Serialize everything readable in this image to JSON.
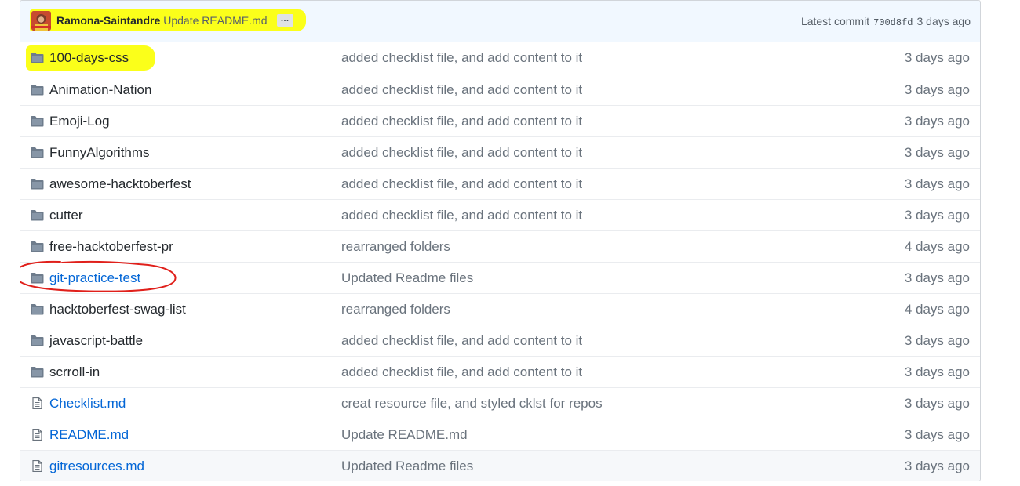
{
  "commit": {
    "author": "Ramona-Saintandre",
    "message": "Update README.md",
    "ellipsis": "…",
    "latest_label": "Latest commit",
    "sha": "700d8fd",
    "time": "3 days ago"
  },
  "files": [
    {
      "name": "100-days-css",
      "type": "folder",
      "message": "added checklist file, and add content to it",
      "age": "3 days ago"
    },
    {
      "name": "Animation-Nation",
      "type": "folder",
      "message": "added checklist file, and add content to it",
      "age": "3 days ago"
    },
    {
      "name": "Emoji-Log",
      "type": "folder",
      "message": "added checklist file, and add content to it",
      "age": "3 days ago"
    },
    {
      "name": "FunnyAlgorithms",
      "type": "folder",
      "message": "added checklist file, and add content to it",
      "age": "3 days ago"
    },
    {
      "name": "awesome-hacktoberfest",
      "type": "folder",
      "message": "added checklist file, and add content to it",
      "age": "3 days ago"
    },
    {
      "name": "cutter",
      "type": "folder",
      "message": "added checklist file, and add content to it",
      "age": "3 days ago"
    },
    {
      "name": "free-hacktoberfest-pr",
      "type": "folder",
      "message": "rearranged folders",
      "age": "4 days ago"
    },
    {
      "name": "git-practice-test",
      "type": "folder",
      "message": "Updated Readme files",
      "age": "3 days ago"
    },
    {
      "name": "hacktoberfest-swag-list",
      "type": "folder",
      "message": "rearranged folders",
      "age": "4 days ago"
    },
    {
      "name": "javascript-battle",
      "type": "folder",
      "message": "added checklist file, and add content to it",
      "age": "3 days ago"
    },
    {
      "name": "scrroll-in",
      "type": "folder",
      "message": "added checklist file, and add content to it",
      "age": "3 days ago"
    },
    {
      "name": "Checklist.md",
      "type": "file",
      "message": "creat resource file, and styled cklst for repos",
      "age": "3 days ago"
    },
    {
      "name": "README.md",
      "type": "file",
      "message": "Update README.md",
      "age": "3 days ago"
    },
    {
      "name": "gitresources.md",
      "type": "file",
      "message": "Updated Readme files",
      "age": "3 days ago"
    }
  ],
  "colors": {
    "highlight_yellow": "#fbff1a",
    "annotation_red": "#e0201b",
    "link_blue": "#0366d6",
    "folder_icon": "#79b8ff"
  }
}
